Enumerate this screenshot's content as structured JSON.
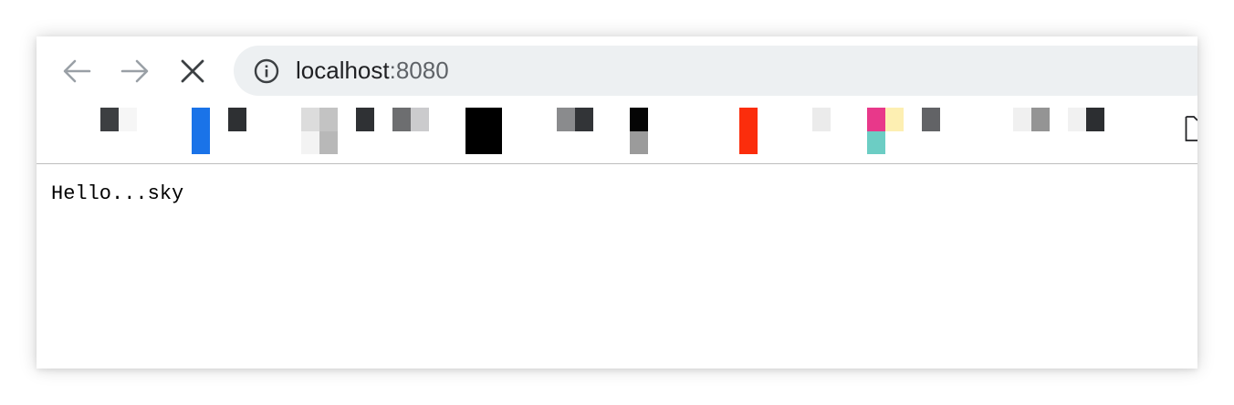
{
  "browser": {
    "nav": {
      "back_icon": "arrow-left-icon",
      "forward_icon": "arrow-right-icon",
      "stop_icon": "close-icon"
    },
    "omnibox": {
      "icon": "info-circle-icon",
      "host": "localhost",
      "port": ":8080"
    },
    "bookmarks_bar": {
      "note": "favicons pixelated/obscured",
      "overflow_icon": "page-icon"
    }
  },
  "page": {
    "body_text": "Hello...sky"
  },
  "colors": {
    "toolbar_bg": "#ffffff",
    "omnibox_bg": "#edf0f2",
    "nav_disabled": "#9aa0a6",
    "nav_active": "#3c4043",
    "divider": "#bdbdbd",
    "text": "#000000"
  }
}
